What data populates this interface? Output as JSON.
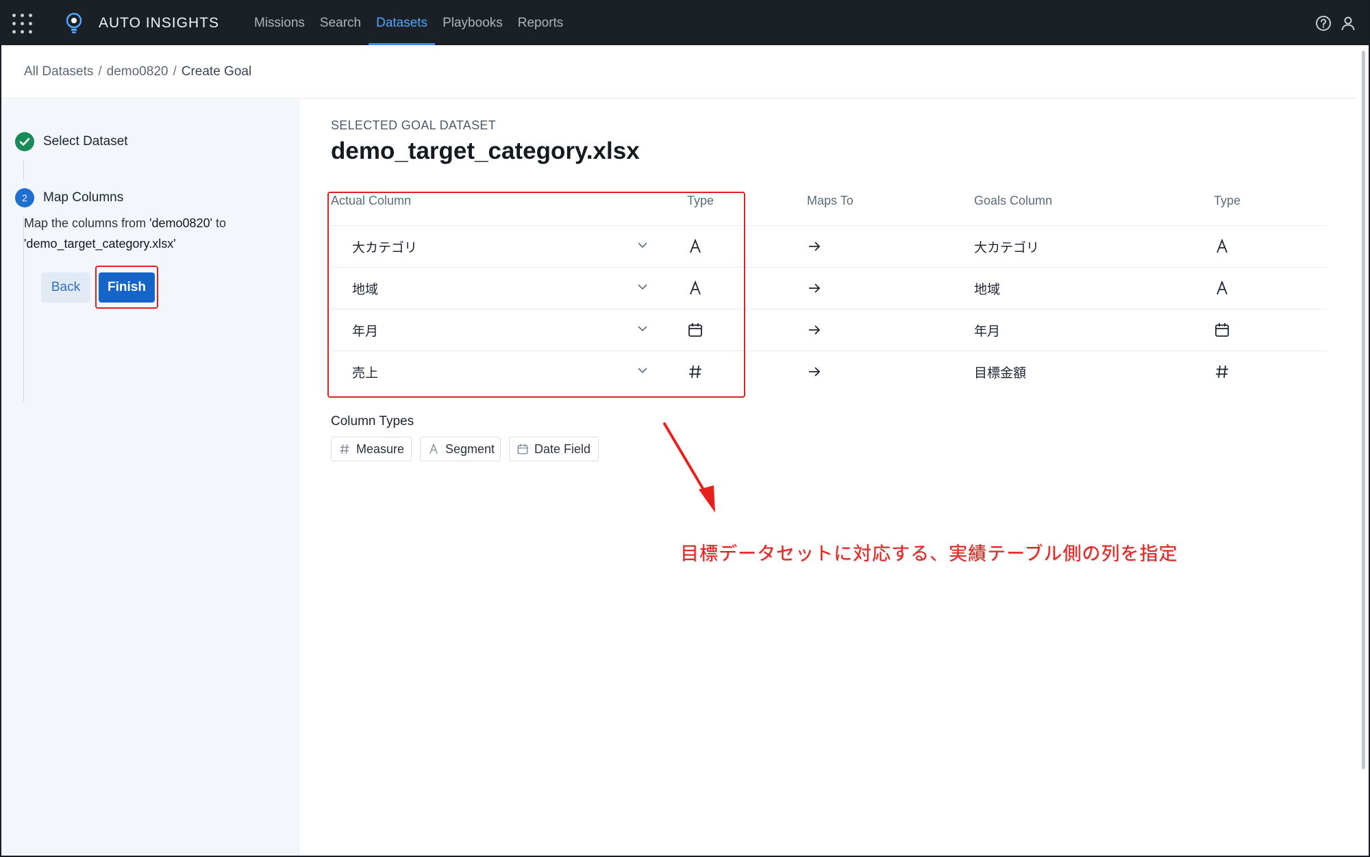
{
  "nav": {
    "brand": "AUTO INSIGHTS",
    "items": [
      {
        "label": "Missions",
        "active": false
      },
      {
        "label": "Search",
        "active": false
      },
      {
        "label": "Datasets",
        "active": true
      },
      {
        "label": "Playbooks",
        "active": false
      },
      {
        "label": "Reports",
        "active": false
      }
    ],
    "icons": [
      "apps-grid-icon",
      "lightbulb-logo-icon",
      "help-icon",
      "user-icon"
    ]
  },
  "breadcrumb": {
    "items": [
      "All Datasets",
      "demo0820",
      "Create Goal"
    ],
    "separator": "/"
  },
  "sidebar": {
    "step1": {
      "title": "Select Dataset",
      "status": "complete"
    },
    "step2": {
      "number": "2",
      "title": "Map Columns",
      "desc_prefix": "Map the columns from ",
      "desc_source": "'demo0820'",
      "desc_mid": " to",
      "desc_target": "'demo_target_category.xlsx'"
    },
    "back_label": "Back",
    "finish_label": "Finish"
  },
  "main": {
    "selected_label": "SELECTED GOAL DATASET",
    "selected_name": "demo_target_category.xlsx",
    "headers": {
      "actual": "Actual Column",
      "type": "Type",
      "maps_to": "Maps To",
      "goals": "Goals Column",
      "goals_type": "Type"
    },
    "rows": [
      {
        "actual": "大カテゴリ",
        "type": "segment",
        "goal": "大カテゴリ",
        "goal_type": "segment"
      },
      {
        "actual": "地域",
        "type": "segment",
        "goal": "地域",
        "goal_type": "segment"
      },
      {
        "actual": "年月",
        "type": "date",
        "goal": "年月",
        "goal_type": "date"
      },
      {
        "actual": "売上",
        "type": "measure",
        "goal": "目標金額",
        "goal_type": "measure"
      }
    ],
    "column_types_title": "Column Types",
    "column_types": [
      {
        "label": "Measure",
        "icon": "hash-icon"
      },
      {
        "label": "Segment",
        "icon": "segment-a-icon"
      },
      {
        "label": "Date Field",
        "icon": "calendar-icon"
      }
    ],
    "annotation": "目標データセットに対応する、実績テーブル側の列を指定"
  },
  "colors": {
    "nav_bg": "#1b1f26",
    "accent": "#1565c8",
    "success": "#1a8a5a",
    "highlight": "#e0201e"
  }
}
